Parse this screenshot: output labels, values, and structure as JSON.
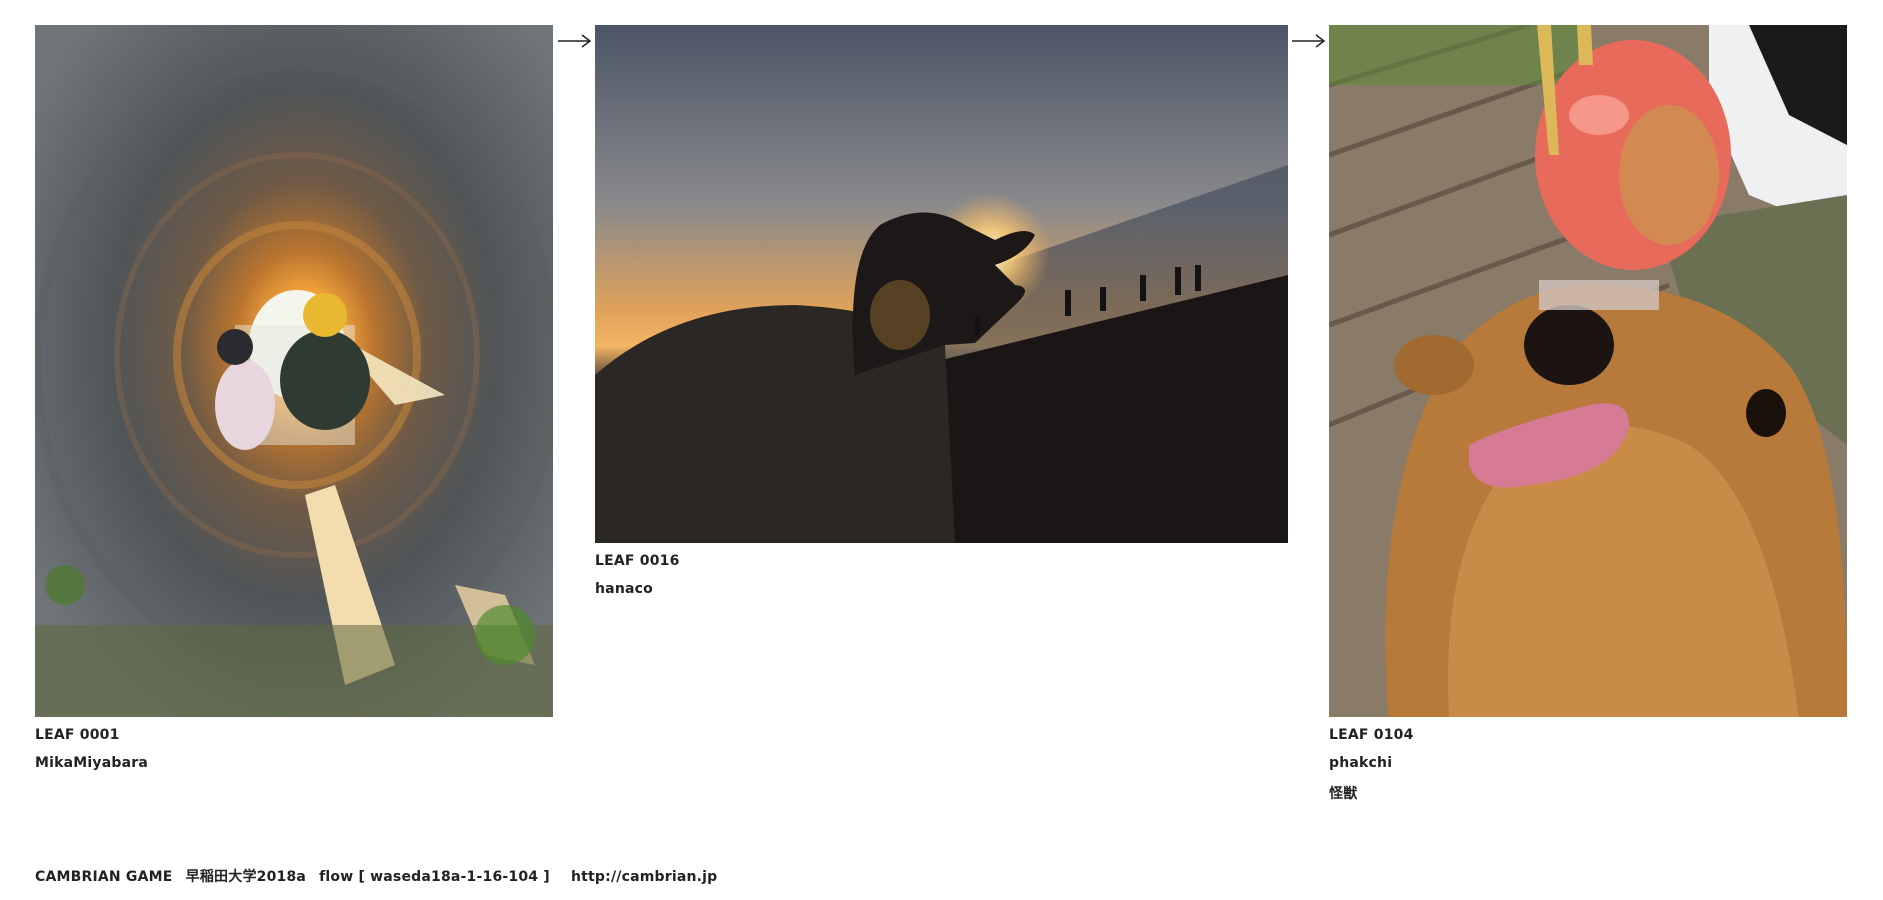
{
  "leaves": [
    {
      "id": "LEAF 0001",
      "author": "MikaMiyabara",
      "note": "",
      "image": "tunnel-children-photo"
    },
    {
      "id": "LEAF 0016",
      "author": "hanaco",
      "note": "",
      "image": "sunset-hand-photo"
    },
    {
      "id": "LEAF 0104",
      "author": "phakchi",
      "note": "怪獣",
      "image": "dog-candy-apple-photo"
    }
  ],
  "arrows": [
    "right-arrow-icon",
    "right-arrow-icon"
  ],
  "footer": {
    "brand": "CAMBRIAN GAME",
    "course": "早稲田大学2018a",
    "flow": "flow [ waseda18a-1-16-104 ]",
    "url": "http://cambrian.jp"
  }
}
